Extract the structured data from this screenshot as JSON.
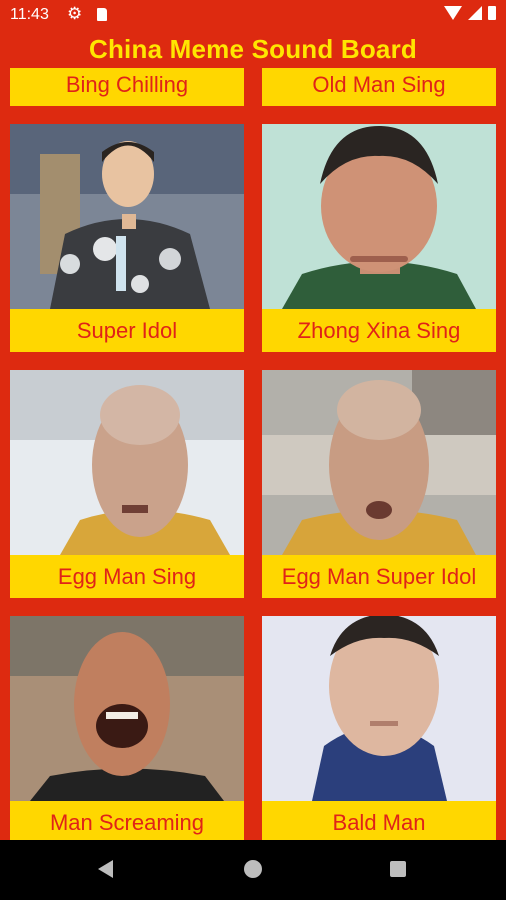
{
  "status": {
    "time": "11:43",
    "settings_icon": "gear-icon",
    "sd_icon": "sd-card-icon"
  },
  "app": {
    "title": "China Meme Sound Board"
  },
  "items": [
    {
      "label": "Bing Chilling"
    },
    {
      "label": "Old Man Sing"
    },
    {
      "label": "Super Idol"
    },
    {
      "label": "Zhong Xina Sing"
    },
    {
      "label": "Egg Man Sing"
    },
    {
      "label": "Egg Man Super Idol"
    },
    {
      "label": "Man Screaming"
    },
    {
      "label": "Bald Man"
    }
  ],
  "colors": {
    "background": "#dd2a10",
    "card": "#ffd700",
    "label_text": "#e02318",
    "title_text": "#ffe600"
  }
}
